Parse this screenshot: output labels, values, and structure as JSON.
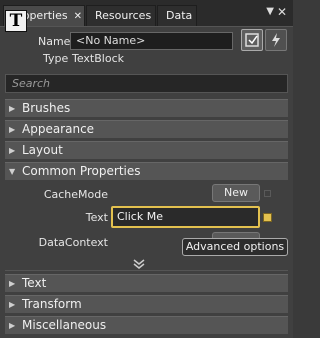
{
  "tabs": [
    {
      "label": "Properties",
      "close": "✕"
    },
    {
      "label": "Resources"
    },
    {
      "label": "Data"
    }
  ],
  "window_controls": {
    "pin": "▼",
    "close": "✕"
  },
  "element": {
    "name_label": "Name",
    "name_value": "<No Name>",
    "type_label": "Type",
    "type_value": "TextBlock",
    "type_icon": "T"
  },
  "search": {
    "placeholder": "Search"
  },
  "categories_top": [
    "Brushes",
    "Appearance",
    "Layout",
    "Common Properties"
  ],
  "common_properties": {
    "cachemode_label": "CacheMode",
    "new_button": "New",
    "text_label": "Text",
    "text_value": "Click Me",
    "datacontext_label": "DataContext",
    "tooltip": "Advanced options"
  },
  "categories_bottom": [
    "Text",
    "Transform",
    "Miscellaneous"
  ],
  "colors": {
    "accent": "#e3c14f",
    "panel": "#404040",
    "category": "#555555"
  }
}
